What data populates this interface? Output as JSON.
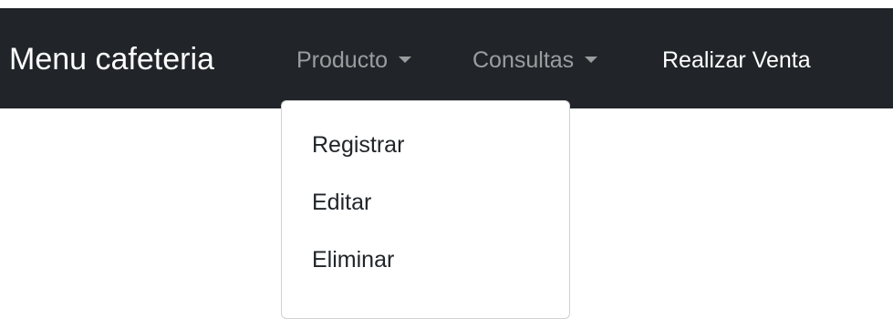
{
  "navbar": {
    "brand": "Menu cafeteria",
    "items": [
      {
        "label": "Producto",
        "has_dropdown": true,
        "state": "open"
      },
      {
        "label": "Consultas",
        "has_dropdown": true,
        "state": "closed"
      },
      {
        "label": "Realizar Venta",
        "has_dropdown": false,
        "state": "active"
      }
    ]
  },
  "dropdown": {
    "items": [
      {
        "label": "Registrar"
      },
      {
        "label": "Editar"
      },
      {
        "label": "Eliminar"
      }
    ]
  },
  "colors": {
    "navbar_bg": "#212529",
    "text_light": "#ffffff",
    "text_muted": "rgba(255,255,255,0.55)",
    "dropdown_text": "#212529"
  },
  "icons": {
    "dropdown_toggle": "caret-down-icon"
  }
}
